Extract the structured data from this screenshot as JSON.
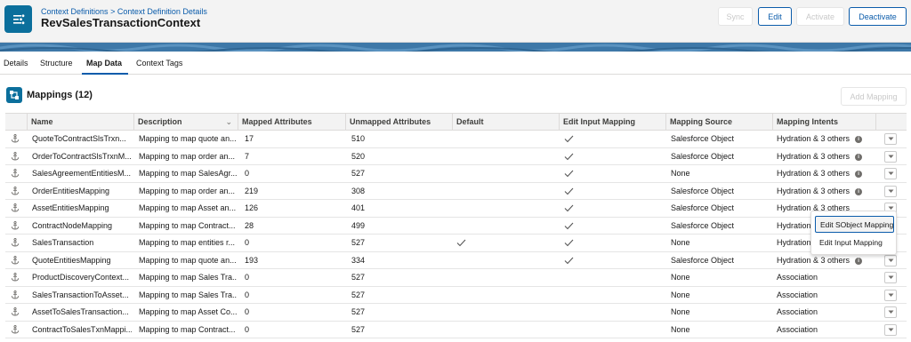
{
  "header": {
    "breadcrumb": [
      "Context Definitions",
      ">",
      "Context Definition Details"
    ],
    "title": "RevSalesTransactionContext",
    "icon": "context-definition-icon",
    "buttons": [
      {
        "label": "Sync",
        "enabled": false
      },
      {
        "label": "Edit",
        "enabled": true
      },
      {
        "label": "Activate",
        "enabled": false
      },
      {
        "label": "Deactivate",
        "enabled": true
      }
    ]
  },
  "tabs": [
    {
      "label": "Details",
      "selected": false
    },
    {
      "label": "Structure",
      "selected": false
    },
    {
      "label": "Map Data",
      "selected": true
    },
    {
      "label": "Context Tags",
      "selected": false
    }
  ],
  "card": {
    "title": "Mappings (12)",
    "icon": "mapping-icon",
    "add_button": "Add Mapping"
  },
  "table": {
    "columns": [
      "Name",
      "Description",
      "Mapped Attributes",
      "Unmapped Attributes",
      "Default",
      "Edit Input Mapping",
      "Mapping Source",
      "Mapping Intents"
    ],
    "rows": [
      {
        "name": "QuoteToContractSlsTrxn...",
        "description": "Mapping to map quote an...",
        "mapped": "17",
        "unmapped": "510",
        "default": false,
        "edit_input": true,
        "source": "Salesforce Object",
        "intents": "Hydration & 3 others",
        "info": true
      },
      {
        "name": "OrderToContractSlsTrxnM...",
        "description": "Mapping to map order an...",
        "mapped": "7",
        "unmapped": "520",
        "default": false,
        "edit_input": true,
        "source": "Salesforce Object",
        "intents": "Hydration & 3 others",
        "info": true
      },
      {
        "name": "SalesAgreementEntitiesM...",
        "description": "Mapping to map SalesAgr...",
        "mapped": "0",
        "unmapped": "527",
        "default": false,
        "edit_input": true,
        "source": "None",
        "intents": "Hydration & 3 others",
        "info": true
      },
      {
        "name": "OrderEntitiesMapping",
        "description": "Mapping to map order an...",
        "mapped": "219",
        "unmapped": "308",
        "default": false,
        "edit_input": true,
        "source": "Salesforce Object",
        "intents": "Hydration & 3 others",
        "info": true
      },
      {
        "name": "AssetEntitiesMapping",
        "description": "Mapping to map Asset an...",
        "mapped": "126",
        "unmapped": "401",
        "default": false,
        "edit_input": true,
        "source": "Salesforce Object",
        "intents": "Hydration & 3 others",
        "info": false
      },
      {
        "name": "ContractNodeMapping",
        "description": "Mapping to map Contract...",
        "mapped": "28",
        "unmapped": "499",
        "default": false,
        "edit_input": true,
        "source": "Salesforce Object",
        "intents": "Hydration",
        "info": false
      },
      {
        "name": "SalesTransaction",
        "description": "Mapping to map entities r...",
        "mapped": "0",
        "unmapped": "527",
        "default": true,
        "edit_input": true,
        "source": "None",
        "intents": "Hydration",
        "info": false
      },
      {
        "name": "QuoteEntitiesMapping",
        "description": "Mapping to map quote an...",
        "mapped": "193",
        "unmapped": "334",
        "default": false,
        "edit_input": true,
        "source": "Salesforce Object",
        "intents": "Hydration & 3 others",
        "info": true
      },
      {
        "name": "ProductDiscoveryContext...",
        "description": "Mapping to map Sales Tra...",
        "mapped": "0",
        "unmapped": "527",
        "default": false,
        "edit_input": false,
        "source": "None",
        "intents": "Association",
        "info": false
      },
      {
        "name": "SalesTransactionToAsset...",
        "description": "Mapping to map Sales Tra...",
        "mapped": "0",
        "unmapped": "527",
        "default": false,
        "edit_input": false,
        "source": "None",
        "intents": "Association",
        "info": false
      },
      {
        "name": "AssetToSalesTransaction...",
        "description": "Mapping to map Asset Co...",
        "mapped": "0",
        "unmapped": "527",
        "default": false,
        "edit_input": false,
        "source": "None",
        "intents": "Association",
        "info": false
      },
      {
        "name": "ContractToSalesTxnMappi...",
        "description": "Mapping to map Contract...",
        "mapped": "0",
        "unmapped": "527",
        "default": false,
        "edit_input": false,
        "source": "None",
        "intents": "Association",
        "info": false
      }
    ]
  },
  "row_menu": {
    "items": [
      "Edit SObject Mapping",
      "Edit Input Mapping"
    ],
    "focused_index": 0,
    "open_row_index": 4
  },
  "colors": {
    "brand": "#0b6f9c",
    "link": "#0b5cab",
    "band": "#3e78a8"
  }
}
